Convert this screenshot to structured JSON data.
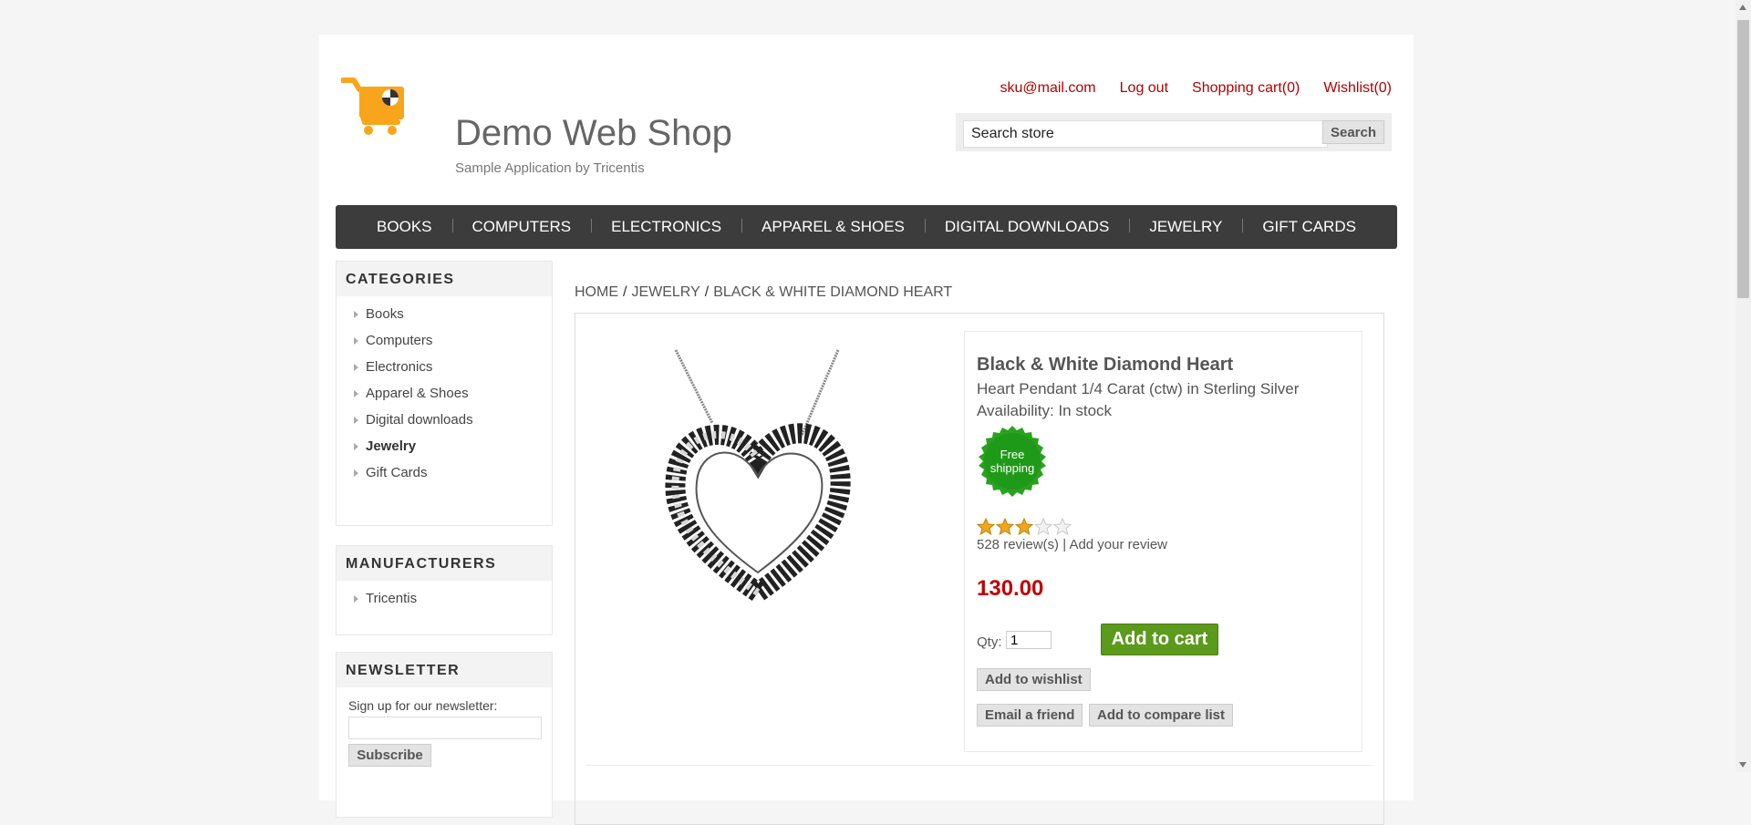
{
  "header": {
    "shop_name": "Demo Web Shop",
    "tagline": "Sample Application by Tricentis",
    "links": {
      "account": "sku@mail.com",
      "logout": "Log out",
      "cart": "Shopping cart(0)",
      "wishlist": "Wishlist(0)"
    },
    "search": {
      "value": "Search store",
      "button": "Search"
    }
  },
  "nav": [
    "BOOKS",
    "COMPUTERS",
    "ELECTRONICS",
    "APPAREL & SHOES",
    "DIGITAL DOWNLOADS",
    "JEWELRY",
    "GIFT CARDS"
  ],
  "sidebar": {
    "categories": {
      "title": "CATEGORIES",
      "items": [
        "Books",
        "Computers",
        "Electronics",
        "Apparel & Shoes",
        "Digital downloads",
        "Jewelry",
        "Gift Cards"
      ],
      "active": "Jewelry"
    },
    "manufacturers": {
      "title": "MANUFACTURERS",
      "items": [
        "Tricentis"
      ]
    },
    "newsletter": {
      "title": "NEWSLETTER",
      "label": "Sign up for our newsletter:",
      "button": "Subscribe"
    }
  },
  "breadcrumb": {
    "home": "HOME",
    "category": "JEWELRY",
    "current": "BLACK & WHITE DIAMOND HEART",
    "separator": "/"
  },
  "product": {
    "name": "Black & White Diamond Heart",
    "short_description": "Heart Pendant 1/4 Carat (ctw) in Sterling Silver",
    "availability": "Availability: In stock",
    "free_shipping": "Free shipping",
    "rating": 3,
    "rating_max": 5,
    "reviews": "528 review(s)",
    "review_separator": "|",
    "add_review": "Add your review",
    "price": "130.00",
    "qty_label": "Qty:",
    "qty_value": "1",
    "add_to_cart": "Add to cart",
    "add_to_wishlist": "Add to wishlist",
    "email_friend": "Email a friend",
    "add_to_compare": "Add to compare list"
  },
  "colors": {
    "link_red": "#b30000",
    "price_red": "#c00000",
    "nav_bg": "#3c3c3c",
    "cart_green": "#5b9a1b",
    "badge_green": "#2aa11f",
    "logo_orange": "#f9a51b"
  },
  "icons": {
    "logo": "shopping-cart-logo",
    "stars": "star-icon",
    "badge": "free-shipping-badge"
  }
}
